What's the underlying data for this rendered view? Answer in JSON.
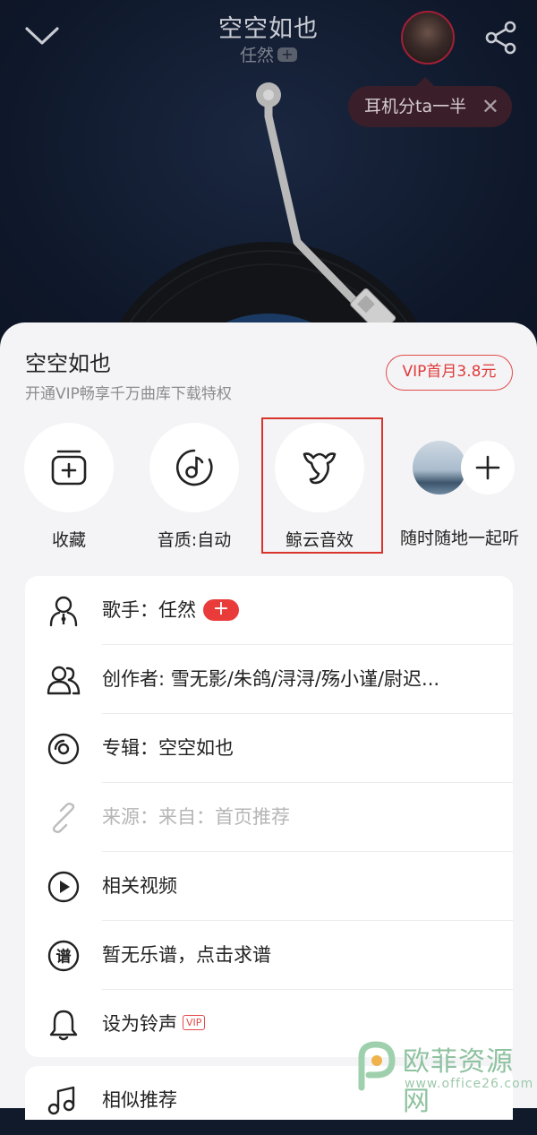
{
  "player": {
    "song_title": "空空如也",
    "artist": "任然",
    "artist_plus": "+",
    "headphone_share": "耳机分ta一半",
    "close_symbol": "✕"
  },
  "sheet": {
    "title": "空空如也",
    "subtitle": "开通VIP畅享千万曲库下载特权",
    "vip_button": "VIP首月3.8元"
  },
  "actions": [
    {
      "label": "收藏",
      "icon": "add-to-collection-icon"
    },
    {
      "label": "音质:自动",
      "icon": "music-note-quality-icon"
    },
    {
      "label": "鲸云音效",
      "icon": "whale-sound-effect-icon"
    },
    {
      "label": "随时随地一起听",
      "icon": "listen-together-icon"
    }
  ],
  "menu": [
    {
      "text": "歌手：任然",
      "icon": "singer-icon",
      "badge": "+"
    },
    {
      "text": "创作者: 雪无影/朱鸽/浔浔/殇小谨/尉迟...",
      "icon": "creators-icon"
    },
    {
      "text": "专辑：空空如也",
      "icon": "album-icon"
    },
    {
      "text": "来源：来自：首页推荐",
      "icon": "source-link-icon",
      "disabled": true
    },
    {
      "text": "相关视频",
      "icon": "video-play-icon"
    },
    {
      "text": "暂无乐谱，点击求谱",
      "icon": "sheet-music-icon",
      "icon_glyph": "谱"
    },
    {
      "text": "设为铃声",
      "icon": "bell-icon",
      "tag": "VIP"
    }
  ],
  "menu2": [
    {
      "text": "相似推荐",
      "icon": "similar-music-icon"
    }
  ],
  "watermark": {
    "text": "欧菲资源网",
    "url": "www.office26.com"
  },
  "colors": {
    "accent_red": "#e03a3a",
    "highlight_box": "#d9342b",
    "sheet_bg": "#f4f4f6",
    "player_bg": "#0f182a"
  }
}
